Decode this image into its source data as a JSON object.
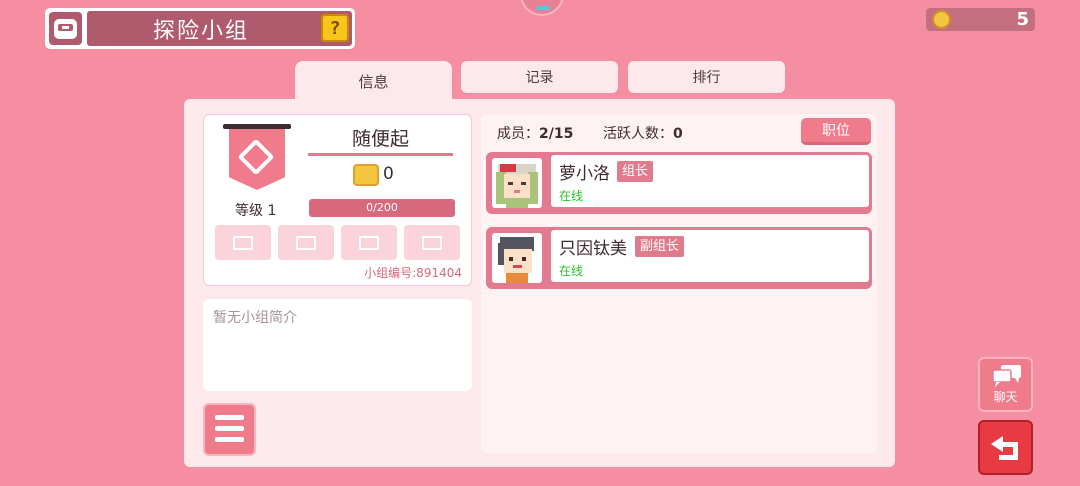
{
  "header": {
    "title": "探险小组",
    "help_icon_text": "?"
  },
  "currency": {
    "value": "5"
  },
  "tabs": [
    {
      "label": "信息",
      "active": true
    },
    {
      "label": "记录",
      "active": false
    },
    {
      "label": "排行",
      "active": false
    }
  ],
  "group": {
    "name": "随便起",
    "score": "0",
    "level_label": "等级 1",
    "xp_text": "0/200",
    "id_text": "小组编号:891404",
    "description_placeholder": "暂无小组简介"
  },
  "members_header": {
    "members_label": "成员：",
    "members_value": "2/15",
    "active_label": "活跃人数：",
    "active_value": "0",
    "position_button": "职位"
  },
  "members": [
    {
      "name": "萝小洛",
      "role": "组长",
      "status": "在线"
    },
    {
      "name": "只因钛美",
      "role": "副组长",
      "status": "在线"
    }
  ],
  "side_buttons": {
    "chat_label": "聊天"
  },
  "colors": {
    "background": "#f58ea0",
    "accent": "#f07b8b",
    "online": "#2cc12c",
    "back_button": "#e83a42"
  }
}
